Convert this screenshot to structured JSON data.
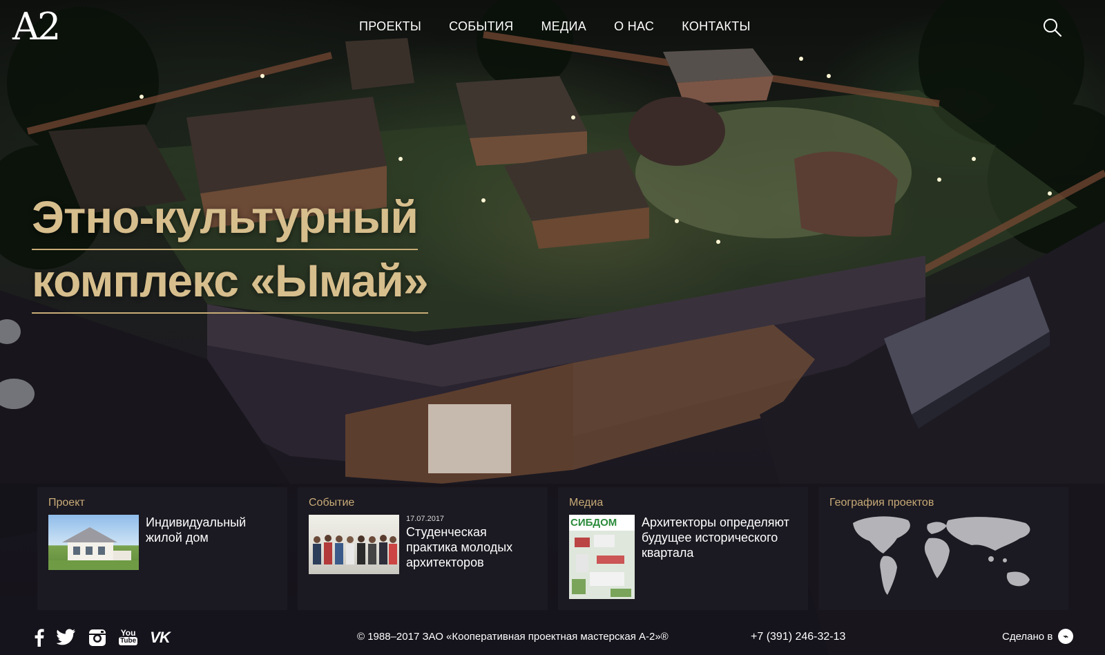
{
  "logo": "A2",
  "nav": [
    {
      "label": "ПРОЕКТЫ"
    },
    {
      "label": "СОБЫТИЯ"
    },
    {
      "label": "МЕДИА"
    },
    {
      "label": "О НАС"
    },
    {
      "label": "КОНТАКТЫ"
    }
  ],
  "hero": {
    "line1": "Этно-культурный",
    "line2": "комплекс «Ымай»"
  },
  "cards": {
    "project": {
      "label": "Проект",
      "title": "Индивидуальный жилой дом"
    },
    "event": {
      "label": "Событие",
      "date": "17.07.2017",
      "title": "Студенческая практика молодых архитекторов"
    },
    "media": {
      "label": "Медиа",
      "thumb_text": "СИБДОМ",
      "title": "Архитекторы определяют будущее исторического квартала"
    },
    "geo": {
      "label": "География проектов"
    }
  },
  "footer": {
    "social": [
      "facebook-icon",
      "twitter-icon",
      "instagram-icon",
      "youtube-icon",
      "vk-icon"
    ],
    "youtube_text_top": "You",
    "youtube_text_bottom": "Tube",
    "vk_text": "VK",
    "copyright": "© 1988–2017 ЗАО «Кооперативная проектная мастерская А-2»®",
    "phone": "+7 (391) 246-32-13",
    "made_in": "Сделано в"
  },
  "colors": {
    "accent": "#d7be8d",
    "card_bg": "#1c1a22",
    "card_label": "#c8ab78"
  }
}
